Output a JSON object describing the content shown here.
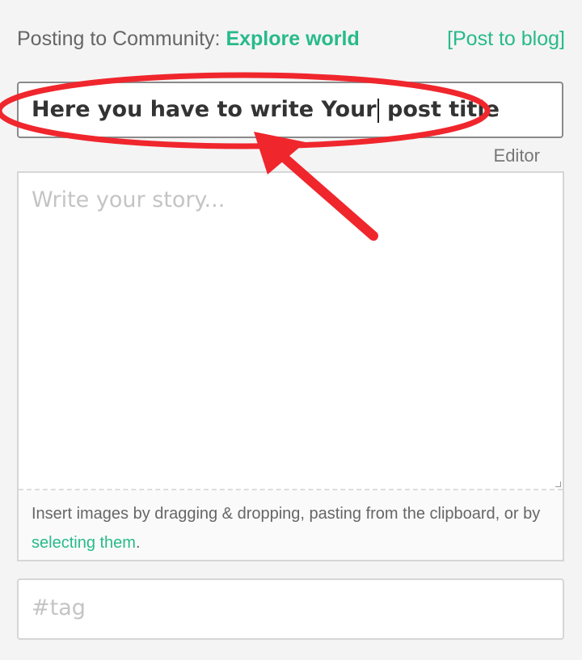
{
  "header": {
    "posting_prefix": "Posting to Community: ",
    "community_name": "Explore world",
    "post_to_blog_label": "[Post to blog]"
  },
  "title_input": {
    "value_before_caret": "Here you have to write Your",
    "value_after_caret": " post title"
  },
  "editor_link_label": "Editor",
  "story": {
    "placeholder": "Write your story...",
    "insert_hint_prefix": "Insert images by dragging & dropping, pasting from the clipboard, or by ",
    "insert_hint_link": "selecting them",
    "insert_hint_suffix": "."
  },
  "tags": {
    "placeholder": "#tag"
  },
  "colors": {
    "accent": "#27ba8a",
    "annotation": "#f0262d"
  }
}
